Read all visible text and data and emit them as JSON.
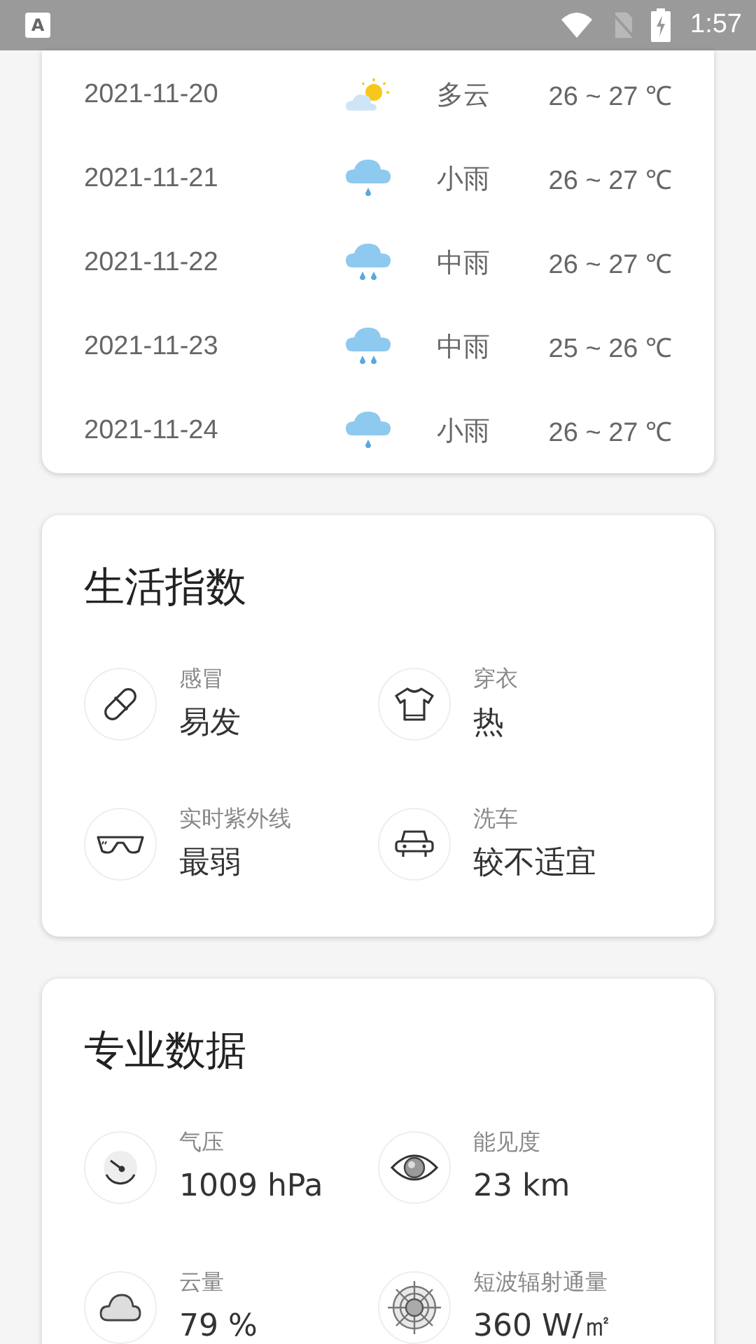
{
  "status_bar": {
    "notification": "A",
    "time": "1:57"
  },
  "forecast": [
    {
      "date": "2021-11-20",
      "kind": "partly-cloudy",
      "weather": "多云",
      "temp": "26 ~ 27 ℃"
    },
    {
      "date": "2021-11-21",
      "kind": "light-rain",
      "weather": "小雨",
      "temp": "26 ~ 27 ℃"
    },
    {
      "date": "2021-11-22",
      "kind": "moderate-rain",
      "weather": "中雨",
      "temp": "26 ~ 27 ℃"
    },
    {
      "date": "2021-11-23",
      "kind": "moderate-rain",
      "weather": "中雨",
      "temp": "25 ~ 26 ℃"
    },
    {
      "date": "2021-11-24",
      "kind": "light-rain",
      "weather": "小雨",
      "temp": "26 ~ 27 ℃"
    }
  ],
  "life_index": {
    "title": "生活指数",
    "items": [
      {
        "label": "感冒",
        "value": "易发"
      },
      {
        "label": "穿衣",
        "value": "热"
      },
      {
        "label": "实时紫外线",
        "value": "最弱"
      },
      {
        "label": "洗车",
        "value": "较不适宜"
      }
    ]
  },
  "pro_data": {
    "title": "专业数据",
    "items": [
      {
        "label": "气压",
        "value": "1009 hPa"
      },
      {
        "label": "能见度",
        "value": "23 km"
      },
      {
        "label": "云量",
        "value": "79 %"
      },
      {
        "label": "短波辐射通量",
        "value": "360 W/㎡"
      }
    ]
  }
}
